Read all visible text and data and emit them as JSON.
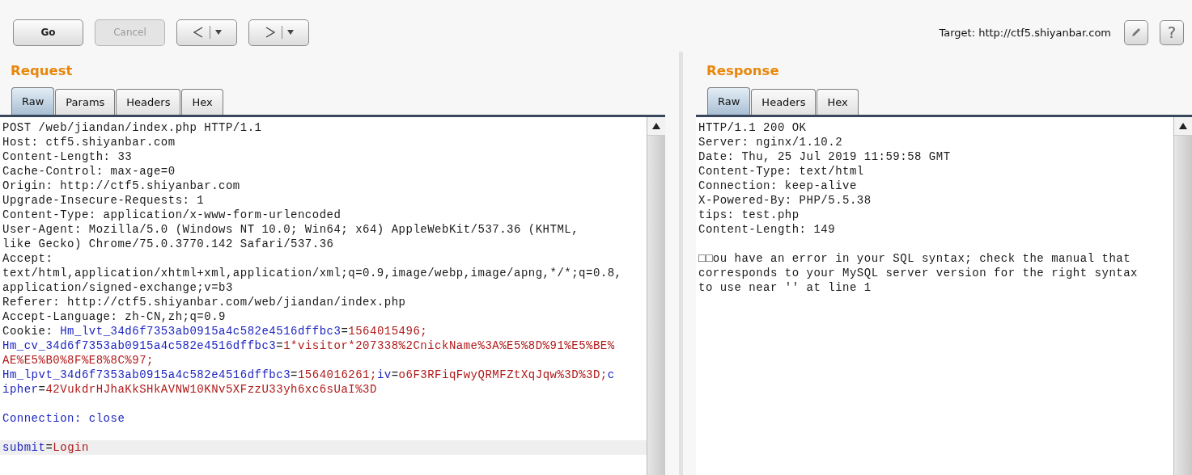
{
  "toolbar": {
    "buttons": [
      {
        "label": "Go",
        "disabled": false
      },
      {
        "label": "Cancel",
        "disabled": true
      }
    ],
    "target_label": "Target: http://ctf5.shiyanbar.com",
    "help_label": "?"
  },
  "request": {
    "title": "Request",
    "tabs": [
      {
        "label": "Raw",
        "selected": true
      },
      {
        "label": "Params",
        "selected": false
      },
      {
        "label": "Headers",
        "selected": false
      },
      {
        "label": "Hex",
        "selected": false
      }
    ],
    "lines": [
      {
        "highlighted": false,
        "segments": [
          {
            "kind": "plain",
            "text": "POST /web/jiandan/index.php HTTP/1.1"
          }
        ]
      },
      {
        "highlighted": false,
        "segments": [
          {
            "kind": "plain",
            "text": "Host: ctf5.shiyanbar.com"
          }
        ]
      },
      {
        "highlighted": false,
        "segments": [
          {
            "kind": "plain",
            "text": "Content-Length: 33"
          }
        ]
      },
      {
        "highlighted": false,
        "segments": [
          {
            "kind": "plain",
            "text": "Cache-Control: max-age=0"
          }
        ]
      },
      {
        "highlighted": false,
        "segments": [
          {
            "kind": "plain",
            "text": "Origin: http://ctf5.shiyanbar.com"
          }
        ]
      },
      {
        "highlighted": false,
        "segments": [
          {
            "kind": "plain",
            "text": "Upgrade-Insecure-Requests: 1"
          }
        ]
      },
      {
        "highlighted": false,
        "segments": [
          {
            "kind": "plain",
            "text": "Content-Type: application/x-www-form-urlencoded"
          }
        ]
      },
      {
        "highlighted": false,
        "segments": [
          {
            "kind": "plain",
            "text": "User-Agent: Mozilla/5.0 (Windows NT 10.0; Win64; x64) AppleWebKit/537.36 (KHTML,"
          }
        ]
      },
      {
        "highlighted": false,
        "segments": [
          {
            "kind": "plain",
            "text": "like Gecko) Chrome/75.0.3770.142 Safari/537.36"
          }
        ]
      },
      {
        "highlighted": false,
        "segments": [
          {
            "kind": "plain",
            "text": "Accept:"
          }
        ]
      },
      {
        "highlighted": false,
        "segments": [
          {
            "kind": "plain",
            "text": "text/html,application/xhtml+xml,application/xml;q=0.9,image/webp,image/apng,*/*;q=0.8,"
          }
        ]
      },
      {
        "highlighted": false,
        "segments": [
          {
            "kind": "plain",
            "text": "application/signed-exchange;v=b3"
          }
        ]
      },
      {
        "highlighted": false,
        "segments": [
          {
            "kind": "plain",
            "text": "Referer: http://ctf5.shiyanbar.com/web/jiandan/index.php"
          }
        ]
      },
      {
        "highlighted": false,
        "segments": [
          {
            "kind": "plain",
            "text": "Accept-Language: zh-CN,zh;q=0.9"
          }
        ]
      },
      {
        "highlighted": false,
        "segments": [
          {
            "kind": "plain",
            "text": "Cookie: "
          },
          {
            "kind": "key",
            "text": "Hm_lvt_34d6f7353ab0915a4c582e4516dffbc3"
          },
          {
            "kind": "plain",
            "text": "="
          },
          {
            "kind": "value",
            "text": "1564015496;"
          }
        ]
      },
      {
        "highlighted": false,
        "segments": [
          {
            "kind": "key",
            "text": "Hm_cv_34d6f7353ab0915a4c582e4516dffbc3"
          },
          {
            "kind": "plain",
            "text": "="
          },
          {
            "kind": "value",
            "text": "1*visitor*207338%2CnickName%3A%E5%8D%91%E5%BE%"
          }
        ]
      },
      {
        "highlighted": false,
        "segments": [
          {
            "kind": "value",
            "text": "AE%E5%B0%8F%E8%8C%97;"
          }
        ]
      },
      {
        "highlighted": false,
        "segments": [
          {
            "kind": "key",
            "text": "Hm_lpvt_34d6f7353ab0915a4c582e4516dffbc3"
          },
          {
            "kind": "plain",
            "text": "="
          },
          {
            "kind": "value",
            "text": "1564016261;"
          },
          {
            "kind": "key",
            "text": "iv"
          },
          {
            "kind": "plain",
            "text": "="
          },
          {
            "kind": "value",
            "text": "o6F3RFiqFwyQRMFZtXqJqw%3D%3D;"
          },
          {
            "kind": "key",
            "text": "c"
          }
        ]
      },
      {
        "highlighted": false,
        "segments": [
          {
            "kind": "key",
            "text": "ipher"
          },
          {
            "kind": "plain",
            "text": "="
          },
          {
            "kind": "value",
            "text": "42VukdrHJhaKkSHkAVNW10KNv5XFzzU33yh6xc6sUaI%3D"
          }
        ]
      },
      {
        "kind": "blank"
      },
      {
        "highlighted": false,
        "segments": [
          {
            "kind": "key",
            "text": "Connection: close"
          }
        ]
      },
      {
        "kind": "blank"
      },
      {
        "highlighted": true,
        "segments": [
          {
            "kind": "key",
            "text": "submit"
          },
          {
            "kind": "plain",
            "text": "="
          },
          {
            "kind": "value",
            "text": "Login"
          }
        ]
      }
    ]
  },
  "response": {
    "title": "Response",
    "tabs": [
      {
        "label": "Raw",
        "selected": true
      },
      {
        "label": "Headers",
        "selected": false
      },
      {
        "label": "Hex",
        "selected": false
      }
    ],
    "lines": [
      {
        "highlighted": false,
        "segments": [
          {
            "kind": "plain",
            "text": "HTTP/1.1 200 OK"
          }
        ]
      },
      {
        "highlighted": false,
        "segments": [
          {
            "kind": "plain",
            "text": "Server: nginx/1.10.2"
          }
        ]
      },
      {
        "highlighted": false,
        "segments": [
          {
            "kind": "plain",
            "text": "Date: Thu, 25 Jul 2019 11:59:58 GMT"
          }
        ]
      },
      {
        "highlighted": false,
        "segments": [
          {
            "kind": "plain",
            "text": "Content-Type: text/html"
          }
        ]
      },
      {
        "highlighted": false,
        "segments": [
          {
            "kind": "plain",
            "text": "Connection: keep-alive"
          }
        ]
      },
      {
        "highlighted": false,
        "segments": [
          {
            "kind": "plain",
            "text": "X-Powered-By: PHP/5.5.38"
          }
        ]
      },
      {
        "highlighted": false,
        "segments": [
          {
            "kind": "plain",
            "text": "tips: test.php"
          }
        ]
      },
      {
        "highlighted": false,
        "segments": [
          {
            "kind": "plain",
            "text": "Content-Length: 149"
          }
        ]
      },
      {
        "kind": "blank"
      },
      {
        "highlighted": false,
        "segments": [
          {
            "kind": "plain",
            "text": "□□ou have an error in your SQL syntax; check the manual that"
          }
        ]
      },
      {
        "highlighted": false,
        "segments": [
          {
            "kind": "plain",
            "text": "corresponds to your MySQL server version for the right syntax"
          }
        ]
      },
      {
        "highlighted": false,
        "segments": [
          {
            "kind": "plain",
            "text": "to use near '' at line 1"
          }
        ]
      }
    ]
  }
}
